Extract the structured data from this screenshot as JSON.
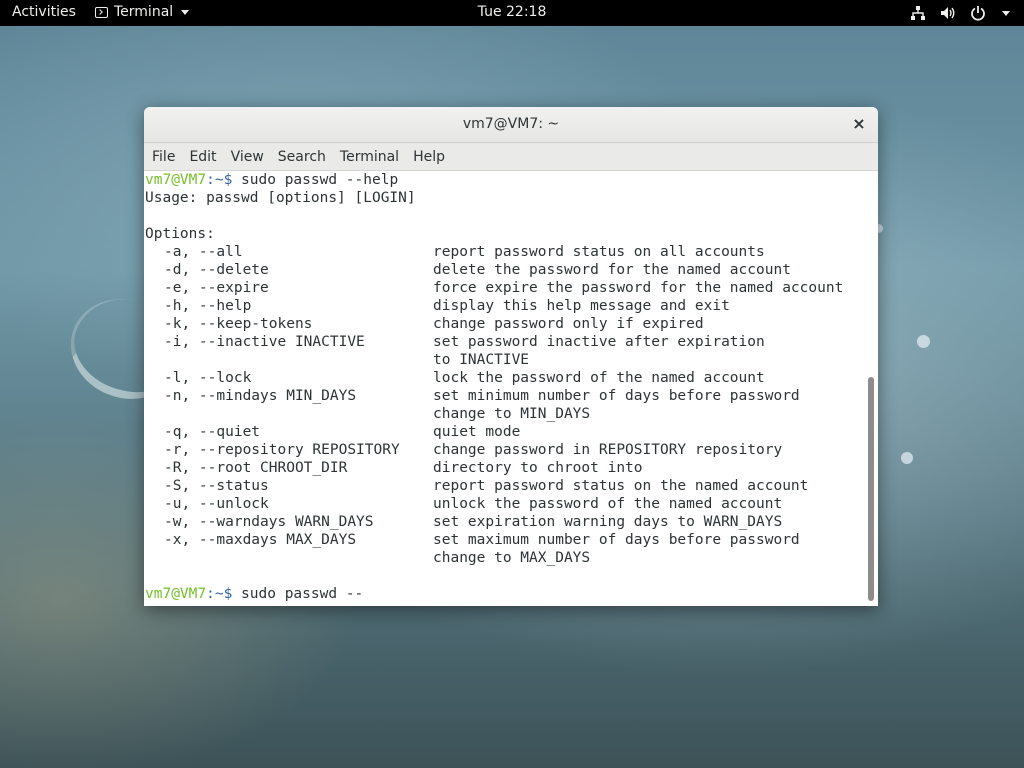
{
  "topbar": {
    "activities": "Activities",
    "app_name": "Terminal",
    "clock": "Tue 22:18"
  },
  "icons": {
    "app": "terminal-icon",
    "network": "network-icon",
    "volume": "volume-icon",
    "power": "power-icon",
    "system_menu": "chevron-down-icon",
    "close": "close-icon"
  },
  "window": {
    "title": "vm7@VM7: ~",
    "close_glyph": "×",
    "menu": [
      "File",
      "Edit",
      "View",
      "Search",
      "Terminal",
      "Help"
    ]
  },
  "terminal": {
    "prompt_user": "vm7@VM7",
    "prompt_sep": ":~$",
    "command1": " sudo passwd --help",
    "usage": "Usage: passwd [options] [LOGIN]",
    "options_header": "Options:",
    "options": [
      {
        "opt": "-a, --all",
        "desc": "report password status on all accounts"
      },
      {
        "opt": "-d, --delete",
        "desc": "delete the password for the named account"
      },
      {
        "opt": "-e, --expire",
        "desc": "force expire the password for the named account"
      },
      {
        "opt": "-h, --help",
        "desc": "display this help message and exit"
      },
      {
        "opt": "-k, --keep-tokens",
        "desc": "change password only if expired"
      },
      {
        "opt": "-i, --inactive INACTIVE",
        "desc": "set password inactive after expiration"
      },
      {
        "opt": "",
        "desc": "to INACTIVE"
      },
      {
        "opt": "-l, --lock",
        "desc": "lock the password of the named account"
      },
      {
        "opt": "-n, --mindays MIN_DAYS",
        "desc": "set minimum number of days before password"
      },
      {
        "opt": "",
        "desc": "change to MIN_DAYS"
      },
      {
        "opt": "-q, --quiet",
        "desc": "quiet mode"
      },
      {
        "opt": "-r, --repository REPOSITORY",
        "desc": "change password in REPOSITORY repository"
      },
      {
        "opt": "-R, --root CHROOT_DIR",
        "desc": "directory to chroot into"
      },
      {
        "opt": "-S, --status",
        "desc": "report password status on the named account"
      },
      {
        "opt": "-u, --unlock",
        "desc": "unlock the password of the named account"
      },
      {
        "opt": "-w, --warndays WARN_DAYS",
        "desc": "set expiration warning days to WARN_DAYS"
      },
      {
        "opt": "-x, --maxdays MAX_DAYS",
        "desc": "set maximum number of days before password"
      },
      {
        "opt": "",
        "desc": "change to MAX_DAYS"
      }
    ],
    "command2": " sudo passwd --"
  },
  "colors": {
    "prompt_user": "#73c02a",
    "prompt_sep": "#3465a4",
    "text": "#2e3436",
    "topbar": "#000000"
  }
}
